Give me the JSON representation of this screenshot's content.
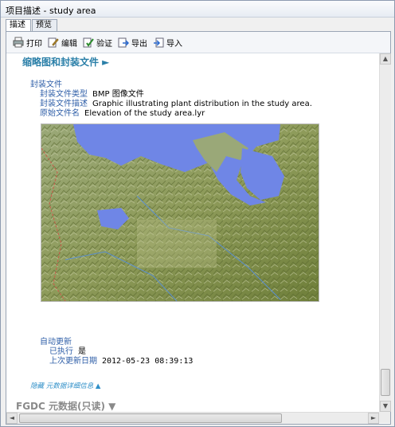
{
  "window": {
    "title": "项目描述 - study area"
  },
  "tabs": [
    {
      "label": "描述"
    },
    {
      "label": "预览"
    }
  ],
  "toolbar": {
    "print": "打印",
    "edit": "编辑",
    "validate": "验证",
    "export": "导出",
    "import": "导入"
  },
  "section": {
    "title": "缩略图和封装文件 ►"
  },
  "package": {
    "group": "封装文件",
    "type_label": "封装文件类型",
    "type_value": "BMP 图像文件",
    "desc_label": "封装文件描述",
    "desc_value": "Graphic illustrating plant distribution in the study area.",
    "name_label": "原始文件名",
    "name_value": "Elevation of the study area.lyr"
  },
  "auto_update": {
    "group": "自动更新",
    "executed_label": "已执行",
    "executed_value": "是",
    "last_label": "上次更新日期",
    "last_value": "2012-05-23   08:39:13"
  },
  "links": {
    "hide_details": "隐藏 元数据详细信息 ▲"
  },
  "footer": {
    "fgdc": "FGDC 元数据(只读) ▼"
  },
  "colors": {
    "accent": "#2a7fa8",
    "label": "#2f5fa8",
    "water": "#6f86e6"
  }
}
